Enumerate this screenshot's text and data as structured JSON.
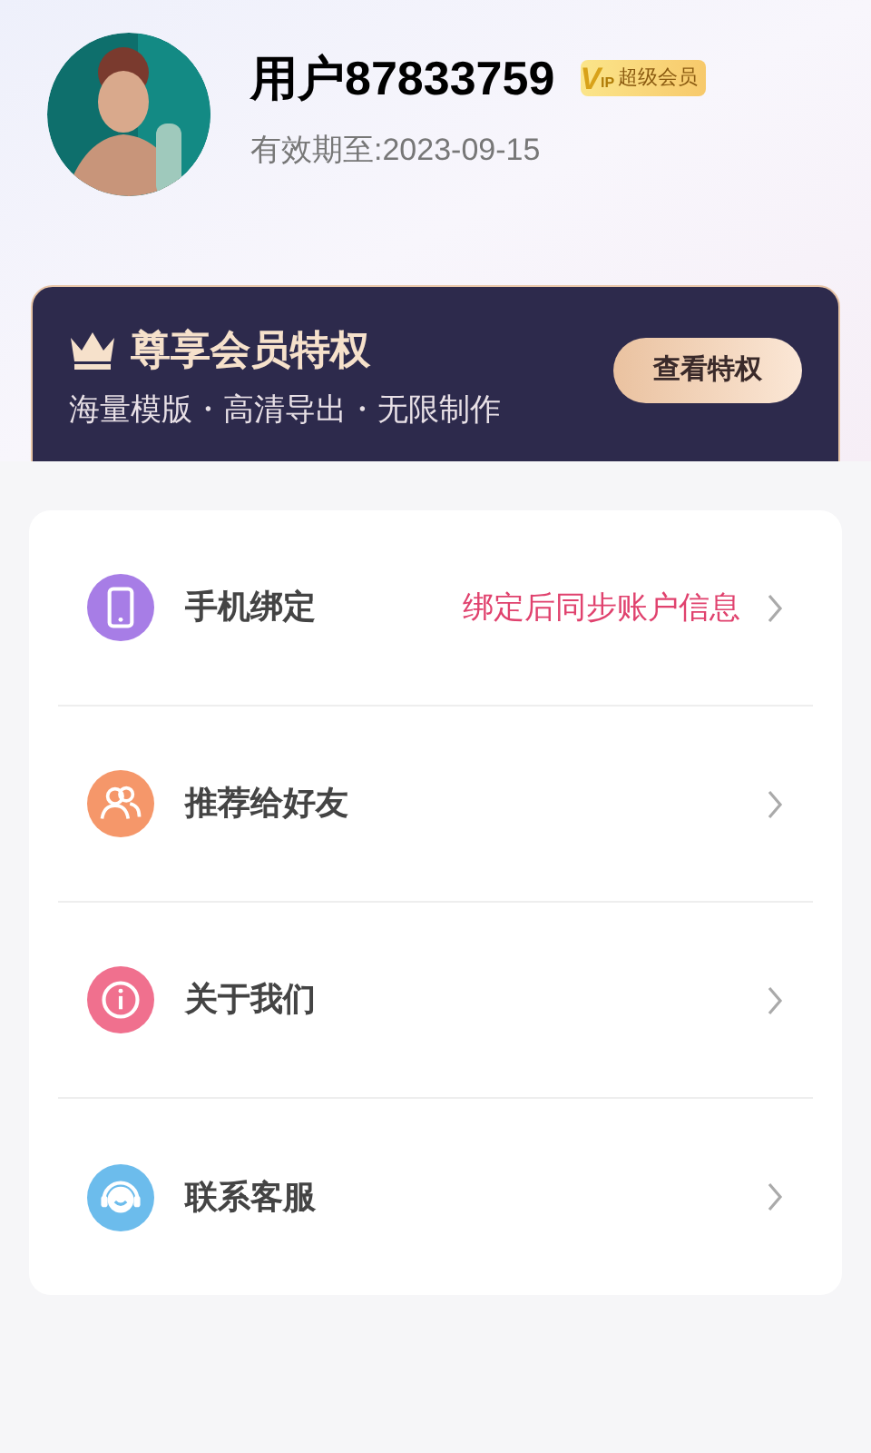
{
  "profile": {
    "username": "用户87833759",
    "vip_logo": [
      "V",
      "IP"
    ],
    "vip_badge": "超级会员",
    "expiry": "有效期至:2023-09-15"
  },
  "banner": {
    "title": "尊享会员特权",
    "subtitle": "海量模版・高清导出・无限制作",
    "button": "查看特权"
  },
  "menu": [
    {
      "kind": "phone",
      "label": "手机绑定",
      "hint": "绑定后同步账户信息",
      "color": "#a77de6"
    },
    {
      "kind": "friends",
      "label": "推荐给好友",
      "color": "#f5976a"
    },
    {
      "kind": "info",
      "label": "关于我们",
      "color": "#f0708e"
    },
    {
      "kind": "support",
      "label": "联系客服",
      "color": "#6cbcec"
    }
  ]
}
